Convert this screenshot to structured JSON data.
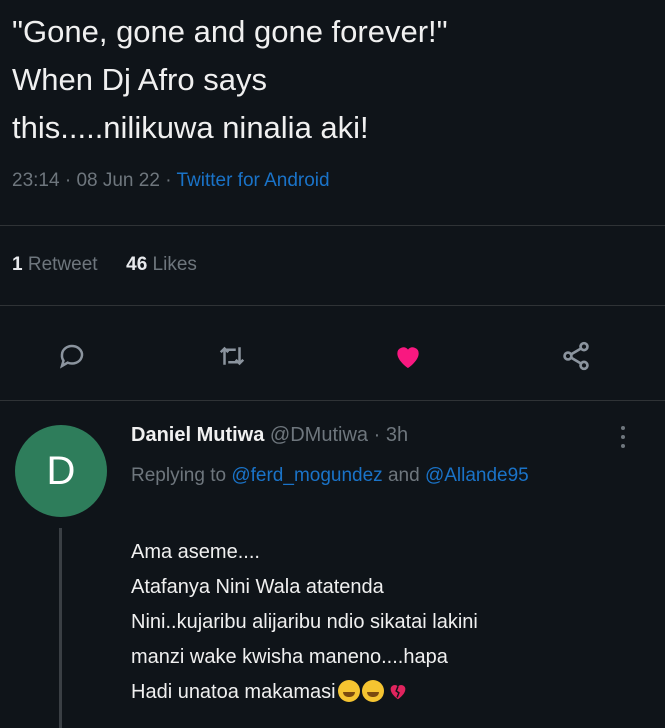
{
  "tweet": {
    "lines": [
      "\"Gone, gone and gone forever!\"",
      "When Dj Afro says",
      "this.....nilikuwa ninalia aki!"
    ],
    "time": "23:14",
    "date": "08 Jun 22",
    "source": "Twitter for Android",
    "separator": "·",
    "retweet_count": "1",
    "retweet_label": "Retweet",
    "like_count": "46",
    "like_label": "Likes"
  },
  "actions": {
    "reply_icon": "reply-icon",
    "retweet_icon": "retweet-icon",
    "like_icon": "heart-icon",
    "share_icon": "share-icon",
    "like_color": "#f91880"
  },
  "reply": {
    "avatar_letter": "D",
    "avatar_color": "#2e7d5b",
    "display_name": "Daniel Mutiwa",
    "handle": "@DMutiwa",
    "separator": "·",
    "time": "3h",
    "replying_prefix": "Replying to",
    "mention_1": "@ferd_mogundez",
    "and_word": "and",
    "mention_2": "@Allande95",
    "body_lines": [
      "Ama aseme....",
      "Atafanya Nini Wala atatenda",
      "Nini..kujaribu alijaribu ndio sikatai lakini",
      "manzi wake kwisha maneno....hapa",
      "Hadi unatoa makamasi"
    ],
    "emojis": [
      "crying-face-icon",
      "crying-face-icon",
      "broken-heart-icon"
    ]
  },
  "colors": {
    "background": "#0f1419",
    "link": "#1a73c8",
    "secondary_text": "#6e767d"
  }
}
